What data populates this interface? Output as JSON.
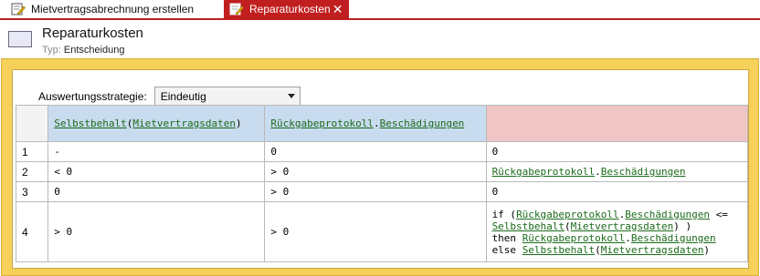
{
  "tabs": [
    {
      "label": "Mietvertragsabrechnung erstellen",
      "icon": "edit-document-icon",
      "active": false
    },
    {
      "label": "Reparaturkosten",
      "icon": "edit-document-icon",
      "active": true,
      "close": "✕"
    }
  ],
  "header": {
    "title": "Reparaturkosten",
    "type_label": "Typ:",
    "type_value": "Entscheidung"
  },
  "strategy": {
    "label": "Auswertungsstrategie:",
    "value": "Eindeutig"
  },
  "colors": {
    "accent": "#c11f1f",
    "frame": "#f6d15a",
    "input_header": "#c9dbee",
    "output_header": "#efc5c5",
    "link": "#1a6b1a"
  },
  "table": {
    "headers": [
      {
        "segments": [
          {
            "t": "Selbstbehalt",
            "link": true
          },
          {
            "t": "(",
            "link": false
          },
          {
            "t": "Mietvertragsdaten",
            "link": true
          },
          {
            "t": ")",
            "link": false
          }
        ]
      },
      {
        "segments": [
          {
            "t": "Rückgabeprotokoll",
            "link": true
          },
          {
            "t": ".",
            "link": false
          },
          {
            "t": "Beschädigungen",
            "link": true
          }
        ]
      },
      {
        "segments": []
      }
    ],
    "rows": [
      {
        "num": "1",
        "cells": [
          [
            [
              {
                "t": "-"
              }
            ]
          ],
          [
            [
              {
                "t": "0"
              }
            ]
          ],
          [
            [
              {
                "t": "0"
              }
            ]
          ]
        ]
      },
      {
        "num": "2",
        "cells": [
          [
            [
              {
                "t": "< 0"
              }
            ]
          ],
          [
            [
              {
                "t": "> 0"
              }
            ]
          ],
          [
            [
              {
                "t": "Rückgabeprotokoll",
                "link": true
              },
              {
                "t": "."
              },
              {
                "t": "Beschädigungen",
                "link": true
              }
            ]
          ]
        ]
      },
      {
        "num": "3",
        "cells": [
          [
            [
              {
                "t": "0"
              }
            ]
          ],
          [
            [
              {
                "t": "> 0"
              }
            ]
          ],
          [
            [
              {
                "t": "0"
              }
            ]
          ]
        ]
      },
      {
        "num": "4",
        "cells": [
          [
            [
              {
                "t": "> 0"
              }
            ]
          ],
          [
            [
              {
                "t": "> 0"
              }
            ]
          ],
          [
            [
              {
                "t": "if ("
              },
              {
                "t": "Rückgabeprotokoll",
                "link": true
              },
              {
                "t": "."
              },
              {
                "t": "Beschädigungen",
                "link": true
              },
              {
                "t": " <="
              }
            ],
            [
              {
                "t": "Selbstbehalt",
                "link": true
              },
              {
                "t": "("
              },
              {
                "t": "Mietvertragsdaten",
                "link": true
              },
              {
                "t": ") )"
              }
            ],
            [
              {
                "t": "then "
              },
              {
                "t": "Rückgabeprotokoll",
                "link": true
              },
              {
                "t": "."
              },
              {
                "t": "Beschädigungen",
                "link": true
              }
            ],
            [
              {
                "t": "else "
              },
              {
                "t": "Selbstbehalt",
                "link": true
              },
              {
                "t": "("
              },
              {
                "t": "Mietvertragsdaten",
                "link": true
              },
              {
                "t": ")"
              }
            ]
          ]
        ]
      }
    ]
  }
}
